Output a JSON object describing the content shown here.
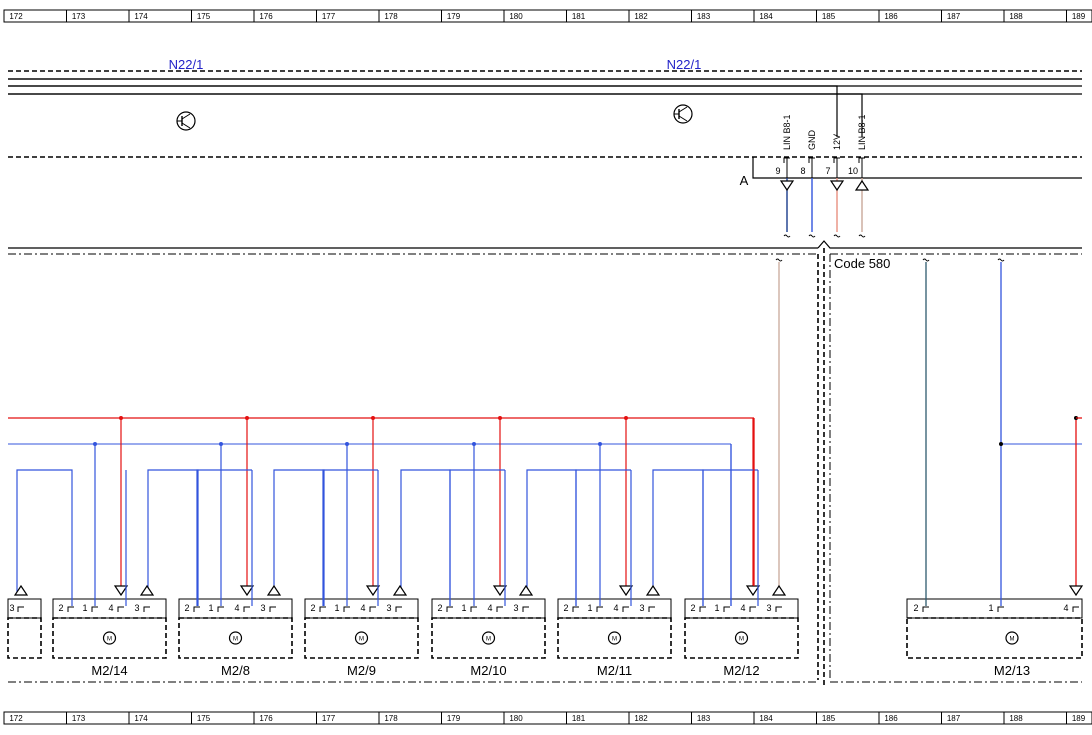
{
  "ruler": [
    "172",
    "173",
    "174",
    "175",
    "176",
    "177",
    "178",
    "179",
    "180",
    "181",
    "182",
    "183",
    "184",
    "185",
    "186",
    "187",
    "188",
    "189"
  ],
  "component_labels": {
    "n22_left": "N22/1",
    "n22_right": "N22/1"
  },
  "connector": {
    "name": "A",
    "signals": [
      "LIN B8-1",
      "GND",
      "12V",
      "LIN B8-1"
    ],
    "pins": [
      "9",
      "8",
      "7",
      "10"
    ]
  },
  "code_label": "Code 580",
  "motors": [
    {
      "name": "M2/14",
      "pins": [
        "2",
        "1",
        "4",
        "3"
      ]
    },
    {
      "name": "M2/8",
      "pins": [
        "2",
        "1",
        "4",
        "3"
      ]
    },
    {
      "name": "M2/9",
      "pins": [
        "2",
        "1",
        "4",
        "3"
      ]
    },
    {
      "name": "M2/10",
      "pins": [
        "2",
        "1",
        "4",
        "3"
      ]
    },
    {
      "name": "M2/11",
      "pins": [
        "2",
        "1",
        "4",
        "3"
      ]
    },
    {
      "name": "M2/12",
      "pins": [
        "2",
        "1",
        "4",
        "3"
      ]
    },
    {
      "name": "M2/13",
      "pins": [
        "2",
        "1",
        "4"
      ]
    }
  ],
  "left_partial_pin": "3",
  "motor_symbol": "M",
  "colors": {
    "red": "#e41010",
    "blue": "#3355dd",
    "darkblue": "#1a3c8c",
    "pink": "#e89080",
    "tan": "#c9a99a",
    "teal": "#2e5a6e",
    "purple": "#6a6ad0"
  }
}
